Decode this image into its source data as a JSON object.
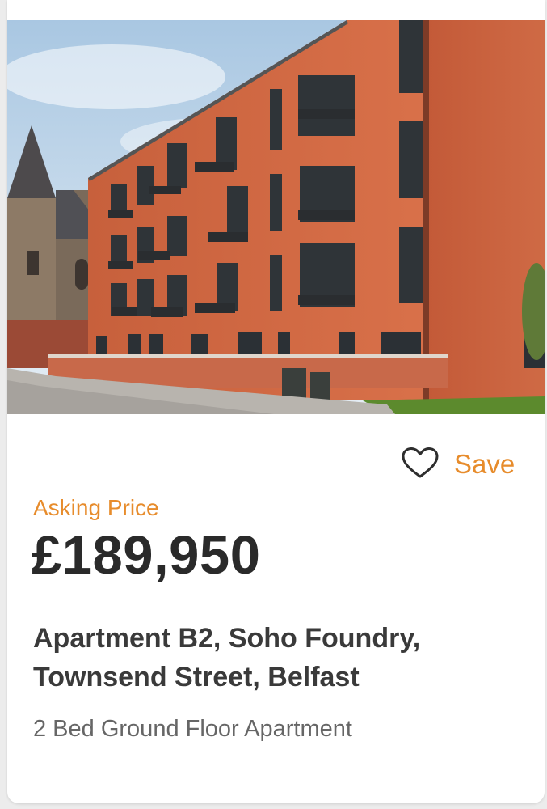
{
  "listing": {
    "save_label": "Save",
    "asking_price_label": "Asking Price",
    "price": "£189,950",
    "address_line_1": "Apartment B2, Soho Foundry,",
    "address_line_2": "Townsend Street, Belfast",
    "description": "2 Bed Ground Floor Apartment"
  },
  "icons": {
    "save": "heart-outline-icon"
  },
  "colors": {
    "accent": "#e78c2c",
    "price_text": "#2a2a2a",
    "address_text": "#3a3a3a",
    "subtitle_text": "#666666",
    "card_background": "#ffffff",
    "page_background": "#ececec"
  }
}
